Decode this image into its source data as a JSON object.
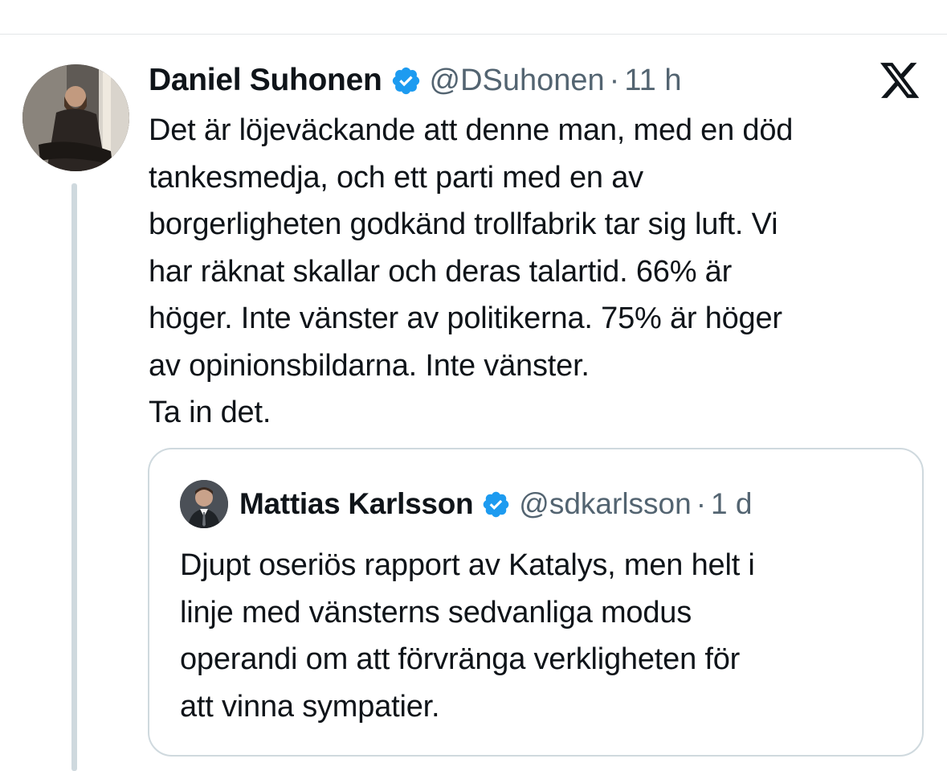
{
  "tweet": {
    "author_name": "Daniel Suhonen",
    "handle": "@DSuhonen",
    "separator": "·",
    "time": "11 h",
    "avatar_icon": "profile-photo",
    "lines": [
      "Det är löjeväckande att denne man, med en död",
      "tankesmedja, och ett parti med en av",
      "borgerligheten godkänd trollfabrik tar sig luft. Vi",
      "har räknat skallar och deras talartid. 66% är",
      "höger. Inte vänster av politikerna. 75% är höger",
      "av opinionsbildarna. Inte vänster.",
      "Ta in det."
    ]
  },
  "quoted_tweet": {
    "author_name": "Mattias Karlsson",
    "handle": "@sdkarlsson",
    "separator": "·",
    "time": "1 d",
    "avatar_icon": "profile-photo",
    "lines": [
      "Djupt oseriös rapport av Katalys, men helt i",
      "linje med vänsterns sedvanliga modus",
      "operandi om att förvränga verkligheten för",
      "att vinna sympatier."
    ]
  },
  "icons": {
    "verified": "verified-badge-icon",
    "brand": "x-logo-icon"
  },
  "colors": {
    "verified_blue": "#1d9bf0",
    "text_primary": "#0f1419",
    "text_secondary": "#536471",
    "border": "#cfd9de"
  }
}
